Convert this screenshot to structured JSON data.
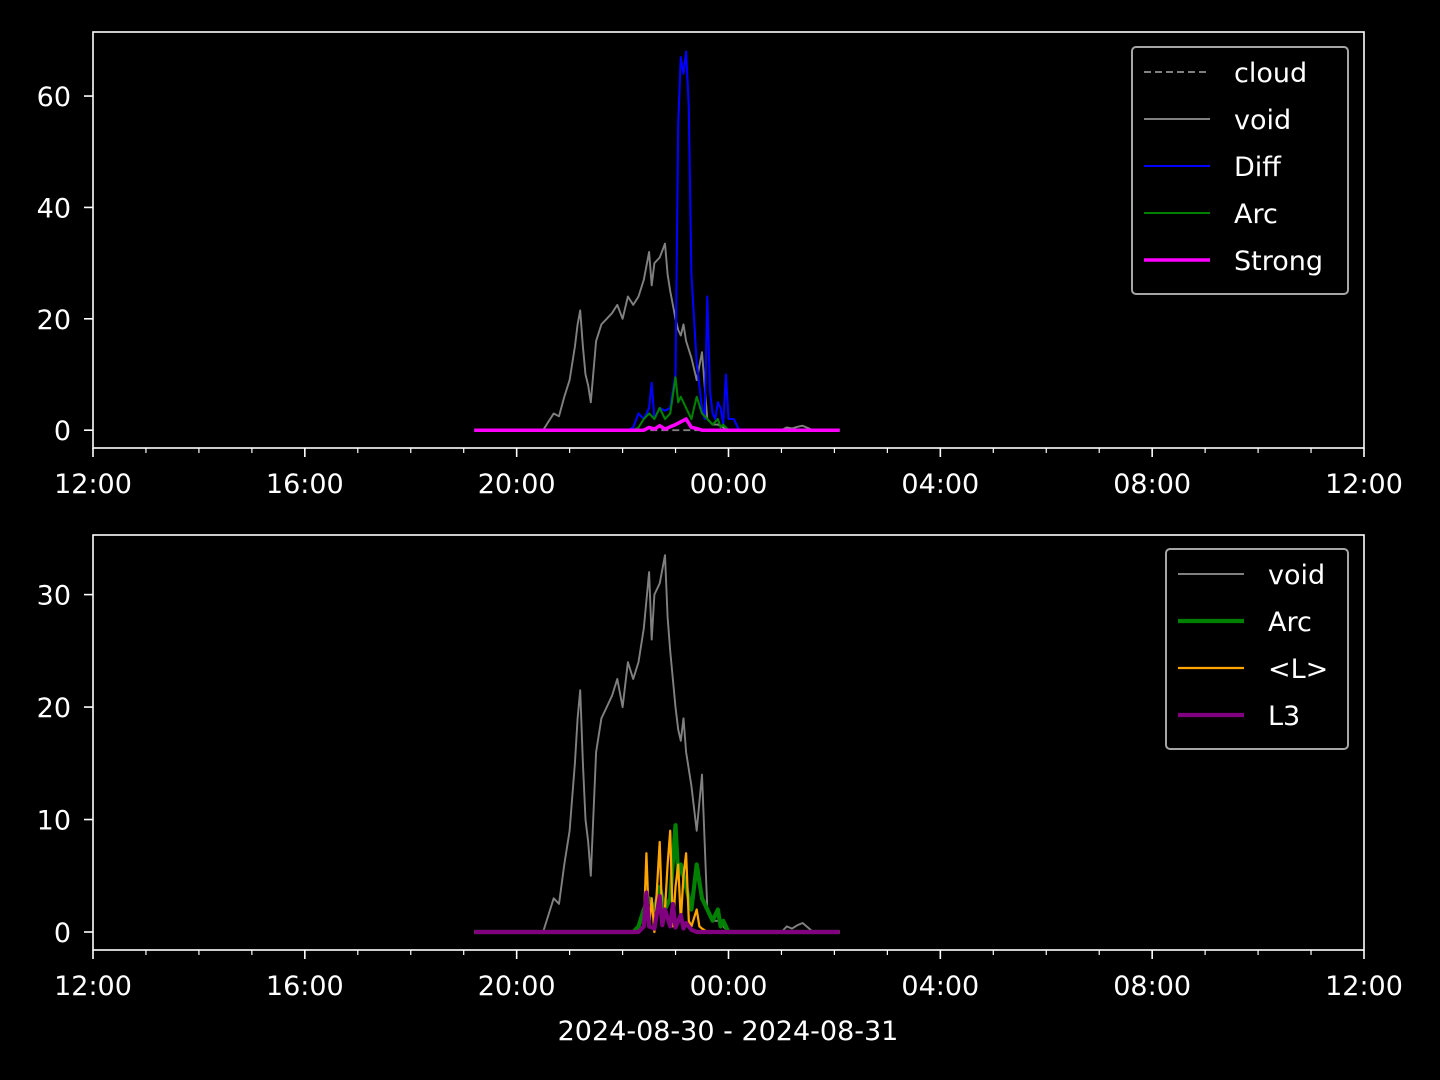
{
  "figure": {
    "background": "#000000",
    "foreground": "#ffffff",
    "xlabel": "2024-08-30 - 2024-08-31"
  },
  "chart_data": [
    {
      "type": "line",
      "title": "",
      "xlabel": "",
      "ylabel": "",
      "x_unit": "hours since 2024-08-30 00:00",
      "xlim": [
        12,
        36
      ],
      "ylim": [
        -3.2,
        71.5
      ],
      "x_tick_values": [
        12,
        16,
        20,
        24,
        28,
        32,
        36
      ],
      "x_tick_labels": [
        "12:00",
        "16:00",
        "20:00",
        "00:00",
        "04:00",
        "08:00",
        "12:00"
      ],
      "x_minor_tick_step": 1,
      "y_ticks": [
        0,
        20,
        40,
        60
      ],
      "legend_position": "top-right",
      "series": [
        {
          "name": "cloud",
          "color": "#808080",
          "dash": true,
          "width": 1.2,
          "x": [
            19.2,
            26.1
          ],
          "y": [
            0,
            0
          ]
        },
        {
          "name": "void",
          "color": "#808080",
          "dash": false,
          "width": 1.2,
          "x": [
            19.2,
            20.5,
            20.6,
            20.7,
            20.8,
            20.9,
            21.0,
            21.1,
            21.15,
            21.2,
            21.25,
            21.3,
            21.35,
            21.4,
            21.5,
            21.6,
            21.7,
            21.8,
            21.9,
            22.0,
            22.1,
            22.2,
            22.3,
            22.4,
            22.5,
            22.55,
            22.6,
            22.7,
            22.8,
            22.85,
            22.9,
            23.0,
            23.05,
            23.1,
            23.15,
            23.2,
            23.3,
            23.4,
            23.5,
            23.6,
            23.7,
            23.8,
            23.9,
            24.0,
            24.5,
            25.0,
            25.1,
            25.2,
            25.3,
            25.4,
            25.5,
            25.6,
            26.1
          ],
          "y": [
            0,
            0,
            1.5,
            3,
            2.5,
            6,
            9,
            15,
            19,
            21.5,
            15,
            10,
            8,
            5,
            16,
            19,
            20,
            21,
            22.5,
            20,
            24,
            22.5,
            24,
            27,
            32,
            26,
            30,
            31,
            33.5,
            28,
            25,
            20,
            18,
            17,
            19,
            16,
            13,
            9,
            14,
            2,
            1,
            1,
            0.5,
            0,
            0,
            0,
            0.5,
            0.3,
            0.6,
            0.8,
            0.4,
            0,
            0
          ]
        },
        {
          "name": "Diff",
          "color": "#0000ff",
          "dash": false,
          "width": 1.3,
          "x": [
            19.2,
            22.1,
            22.2,
            22.3,
            22.4,
            22.5,
            22.55,
            22.6,
            22.7,
            22.8,
            22.9,
            23.0,
            23.05,
            23.1,
            23.15,
            23.2,
            23.25,
            23.3,
            23.4,
            23.5,
            23.55,
            23.6,
            23.65,
            23.7,
            23.75,
            23.8,
            23.85,
            23.9,
            23.95,
            24.0,
            24.1,
            24.2,
            26.1
          ],
          "y": [
            0,
            0,
            0.5,
            3,
            2,
            4,
            8.5,
            2,
            4,
            3.5,
            4,
            10,
            55,
            67,
            64,
            68,
            58,
            28,
            12,
            4,
            2,
            24,
            7,
            3,
            2,
            5,
            4,
            1,
            10,
            2,
            2,
            0,
            0
          ]
        },
        {
          "name": "Arc",
          "color": "#008000",
          "dash": false,
          "width": 1.3,
          "x": [
            19.2,
            22.2,
            22.3,
            22.4,
            22.5,
            22.6,
            22.7,
            22.8,
            22.9,
            23.0,
            23.05,
            23.1,
            23.2,
            23.3,
            23.4,
            23.5,
            23.6,
            23.7,
            23.8,
            23.85,
            23.9,
            24.0,
            26.1
          ],
          "y": [
            0,
            0,
            0.5,
            2,
            3,
            2,
            4,
            2,
            3,
            9.5,
            5,
            6,
            4,
            2,
            6,
            3,
            2,
            1,
            2,
            0.5,
            1,
            0,
            0
          ]
        },
        {
          "name": "Strong",
          "color": "#ff00ff",
          "dash": false,
          "width": 2.2,
          "x": [
            19.2,
            22.4,
            22.5,
            22.6,
            22.7,
            22.8,
            22.9,
            23.0,
            23.1,
            23.2,
            23.3,
            23.4,
            23.5,
            26.1
          ],
          "y": [
            0,
            0,
            0.5,
            0.2,
            0.8,
            0.2,
            0.6,
            1,
            1.5,
            2,
            0.5,
            0.3,
            0,
            0
          ]
        }
      ]
    },
    {
      "type": "line",
      "title": "",
      "xlabel": "2024-08-30 - 2024-08-31",
      "ylabel": "",
      "x_unit": "hours since 2024-08-30 00:00",
      "xlim": [
        12,
        36
      ],
      "ylim": [
        -1.6,
        35.3
      ],
      "x_tick_values": [
        12,
        16,
        20,
        24,
        28,
        32,
        36
      ],
      "x_tick_labels": [
        "12:00",
        "16:00",
        "20:00",
        "00:00",
        "04:00",
        "08:00",
        "12:00"
      ],
      "x_minor_tick_step": 1,
      "y_ticks": [
        0,
        10,
        20,
        30
      ],
      "legend_position": "top-right",
      "series": [
        {
          "name": "void",
          "color": "#808080",
          "dash": false,
          "width": 1.2,
          "x": [
            19.2,
            20.5,
            20.6,
            20.7,
            20.8,
            20.9,
            21.0,
            21.1,
            21.15,
            21.2,
            21.25,
            21.3,
            21.35,
            21.4,
            21.5,
            21.6,
            21.7,
            21.8,
            21.9,
            22.0,
            22.1,
            22.2,
            22.3,
            22.4,
            22.5,
            22.55,
            22.6,
            22.7,
            22.8,
            22.85,
            22.9,
            23.0,
            23.05,
            23.1,
            23.15,
            23.2,
            23.3,
            23.4,
            23.5,
            23.6,
            23.7,
            23.8,
            23.9,
            24.0,
            24.5,
            25.0,
            25.1,
            25.2,
            25.3,
            25.4,
            25.5,
            25.6,
            26.1
          ],
          "y": [
            0,
            0,
            1.5,
            3,
            2.5,
            6,
            9,
            15,
            19,
            21.5,
            15,
            10,
            8,
            5,
            16,
            19,
            20,
            21,
            22.5,
            20,
            24,
            22.5,
            24,
            27,
            32,
            26,
            30,
            31,
            33.5,
            28,
            25,
            20,
            18,
            17,
            19,
            16,
            13,
            9,
            14,
            2,
            1,
            1,
            0.5,
            0,
            0,
            0,
            0.5,
            0.3,
            0.6,
            0.8,
            0.4,
            0,
            0
          ]
        },
        {
          "name": "Arc",
          "color": "#008000",
          "dash": false,
          "width": 2.6,
          "x": [
            19.2,
            22.2,
            22.3,
            22.4,
            22.5,
            22.6,
            22.7,
            22.8,
            22.9,
            23.0,
            23.05,
            23.1,
            23.2,
            23.3,
            23.4,
            23.5,
            23.6,
            23.7,
            23.8,
            23.85,
            23.9,
            24.0,
            26.1
          ],
          "y": [
            0,
            0,
            0.5,
            2,
            3,
            2,
            4,
            2,
            3,
            9.5,
            5,
            6,
            4,
            2,
            6,
            3,
            2,
            1,
            2,
            0.5,
            1,
            0,
            0
          ]
        },
        {
          "name": "<L>",
          "color": "#ffa500",
          "dash": false,
          "width": 1.4,
          "x": [
            19.2,
            22.3,
            22.4,
            22.45,
            22.5,
            22.55,
            22.6,
            22.7,
            22.75,
            22.8,
            22.85,
            22.9,
            22.95,
            23.0,
            23.05,
            23.1,
            23.15,
            23.2,
            23.25,
            23.3,
            23.4,
            23.45,
            23.5,
            23.6,
            26.1
          ],
          "y": [
            0,
            0,
            0.5,
            7,
            0.5,
            3,
            0,
            8,
            1,
            2,
            6,
            9,
            0.5,
            4,
            6,
            1,
            5,
            7,
            1,
            0.5,
            2,
            0.5,
            0.3,
            0,
            0
          ]
        },
        {
          "name": "L3",
          "color": "#800080",
          "dash": false,
          "width": 2.6,
          "x": [
            19.2,
            22.3,
            22.4,
            22.45,
            22.5,
            22.6,
            22.7,
            22.75,
            22.8,
            22.9,
            22.95,
            23.0,
            23.1,
            23.15,
            23.2,
            23.3,
            23.4,
            26.1
          ],
          "y": [
            0,
            0,
            0.5,
            3.5,
            0.5,
            0.3,
            3.2,
            0.6,
            2,
            0.5,
            2.5,
            0.4,
            1.5,
            0.3,
            0.8,
            0.2,
            0,
            0
          ]
        }
      ]
    }
  ]
}
